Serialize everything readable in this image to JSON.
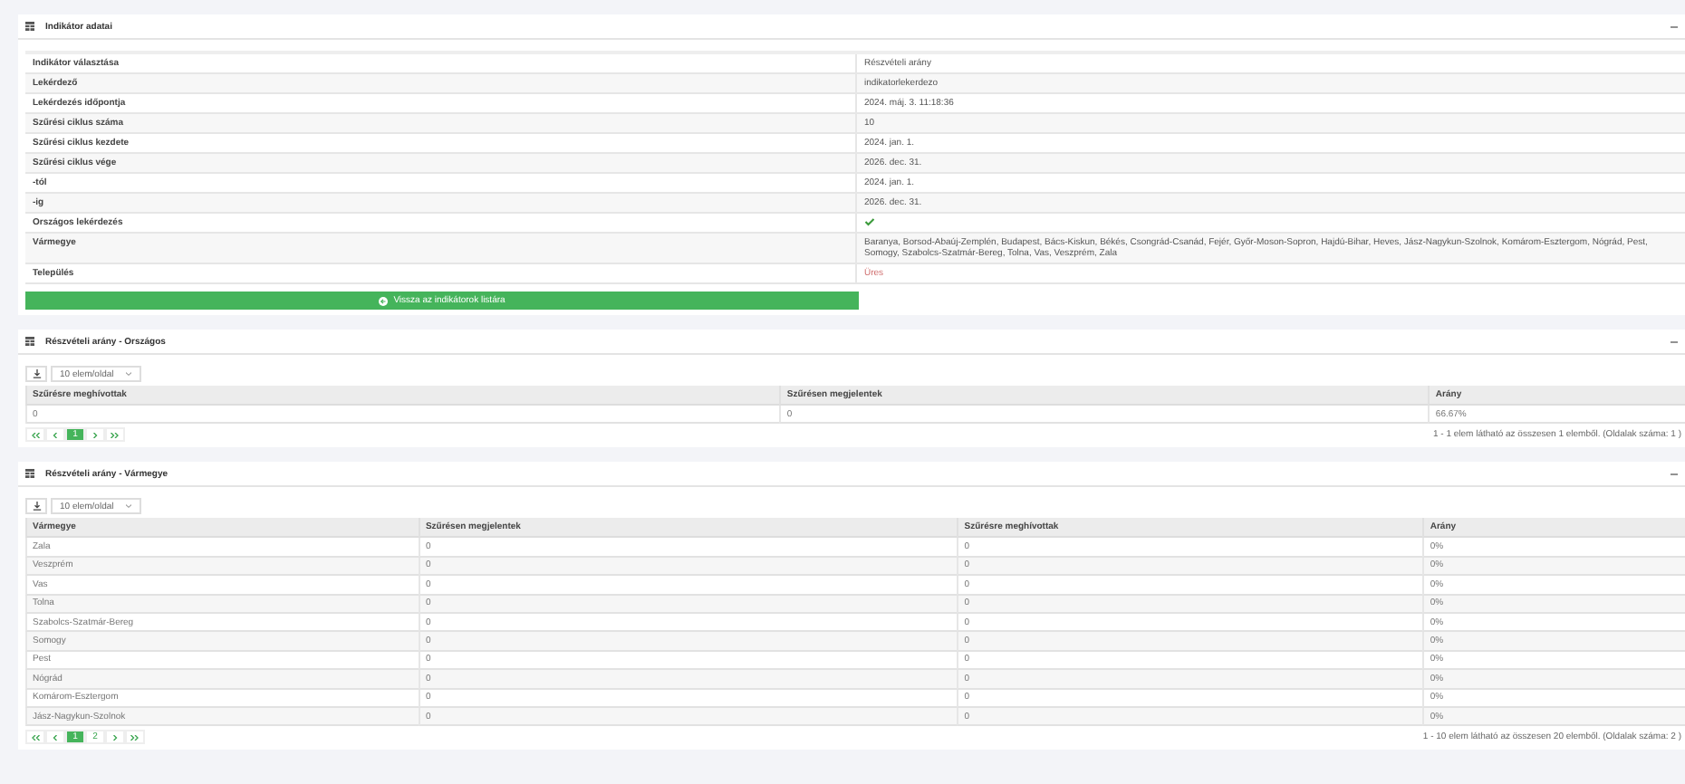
{
  "indicator_card": {
    "title": "Indikátor adatai",
    "details": [
      {
        "label": "Indikátor választása",
        "value": "Részvételi arány",
        "kind": "text"
      },
      {
        "label": "Lekérdező",
        "value": "indikatorlekerdezo",
        "kind": "text"
      },
      {
        "label": "Lekérdezés időpontja",
        "value": "2024. máj. 3. 11:18:36",
        "kind": "text"
      },
      {
        "label": "Szűrési ciklus száma",
        "value": "10",
        "kind": "text"
      },
      {
        "label": "Szűrési ciklus kezdete",
        "value": "2024. jan. 1.",
        "kind": "text"
      },
      {
        "label": "Szűrési ciklus vége",
        "value": "2026. dec. 31.",
        "kind": "text"
      },
      {
        "label": "-tól",
        "value": "2024. jan. 1.",
        "kind": "text"
      },
      {
        "label": "-ig",
        "value": "2026. dec. 31.",
        "kind": "text"
      },
      {
        "label": "Országos lekérdezés",
        "checked": true,
        "kind": "check"
      },
      {
        "label": "Vármegye",
        "value": "Baranya, Borsod-Abaúj-Zemplén, Budapest, Bács-Kiskun, Békés, Csongrád-Csanád, Fejér, Győr-Moson-Sopron, Hajdú-Bihar, Heves, Jász-Nagykun-Szolnok, Komárom-Esztergom, Nógrád, Pest, Somogy, Szabolcs-Szatmár-Bereg, Tolna, Vas, Veszprém, Zala",
        "kind": "text"
      },
      {
        "label": "Település",
        "value": "Üres",
        "kind": "empty"
      }
    ],
    "button": "Vissza az indikátorok listára"
  },
  "national_card": {
    "title": "Részvételi arány - Országos",
    "page_size": "10 elem/oldal",
    "columns": [
      "Szűrésre meghívottak",
      "Szűrésen megjelentek",
      "Arány"
    ],
    "rows": [
      [
        "0",
        "0",
        "66.67%"
      ]
    ],
    "pager": [
      {
        "label": "1",
        "selected": true
      }
    ],
    "summary": "1 - 1 elem látható az összesen 1 elemből. (Oldalak száma: 1 )"
  },
  "county_card": {
    "title": "Részvételi arány - Vármegye",
    "page_size": "10 elem/oldal",
    "columns": [
      "Vármegye",
      "Szűrésen megjelentek",
      "Szűrésre meghívottak",
      "Arány"
    ],
    "rows": [
      [
        "Zala",
        "0",
        "0",
        "0%"
      ],
      [
        "Veszprém",
        "0",
        "0",
        "0%"
      ],
      [
        "Vas",
        "0",
        "0",
        "0%"
      ],
      [
        "Tolna",
        "0",
        "0",
        "0%"
      ],
      [
        "Szabolcs-Szatmár-Bereg",
        "0",
        "0",
        "0%"
      ],
      [
        "Somogy",
        "0",
        "0",
        "0%"
      ],
      [
        "Pest",
        "0",
        "0",
        "0%"
      ],
      [
        "Nógrád",
        "0",
        "0",
        "0%"
      ],
      [
        "Komárom-Esztergom",
        "0",
        "0",
        "0%"
      ],
      [
        "Jász-Nagykun-Szolnok",
        "0",
        "0",
        "0%"
      ]
    ],
    "pager": [
      {
        "label": "1",
        "selected": true
      },
      {
        "label": "2",
        "selected": false
      }
    ],
    "summary": "1 - 10 elem látható az összesen 20 elemből. (Oldalak száma: 2 )"
  }
}
